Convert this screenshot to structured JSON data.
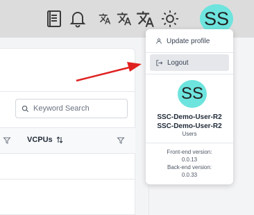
{
  "header": {
    "icons": [
      "book-icon",
      "bell-icon",
      "translate-small-icon",
      "translate-medium-icon",
      "translate-large-icon",
      "sun-icon"
    ],
    "avatar_initials": "SS"
  },
  "table": {
    "search_placeholder": "Keyword Search",
    "columns": [
      {
        "label": "VCPUs"
      }
    ]
  },
  "user_menu": {
    "items": [
      {
        "label": "Update profile",
        "icon": "user-icon"
      },
      {
        "label": "Logout",
        "icon": "logout-icon"
      }
    ],
    "avatar_initials": "SS",
    "user_name_line1": "SSC-Demo-User-R2",
    "user_name_line2": "SSC-Demo-User-R2",
    "user_role": "Users",
    "frontend_label": "Front-end version:",
    "frontend_version": "0.0.13",
    "backend_label": "Back-end version:",
    "backend_version": "0.0.33"
  },
  "colors": {
    "avatar": "#6ee4de",
    "arrow": "#e02020"
  }
}
